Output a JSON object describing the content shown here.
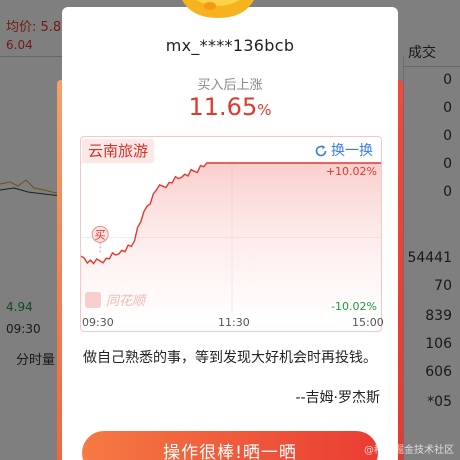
{
  "background_app": {
    "avg_price_label": "均价: 5.8",
    "price_top": "6.04",
    "price_bottom": "4.94",
    "time_start": "09:30",
    "tab_label": "分时量",
    "col_header": "成交",
    "right_column": [
      "0",
      "0",
      "0",
      "0",
      "0",
      "54441",
      "70",
      "839",
      "106",
      "606",
      "*05"
    ]
  },
  "modal": {
    "username": "mx_****136bcb",
    "result_label": "买入后上涨",
    "gain_value": "11.65",
    "gain_unit": "%",
    "stock_name": "云南旅游",
    "swap_label": "换一换",
    "buy_marker": "买",
    "brand": "同花顺",
    "axis_top": "+10.02%",
    "axis_bottom": "-10.02%",
    "time_labels": [
      "09:30",
      "11:30",
      "15:00"
    ],
    "quote": "做自己熟悉的事，等到发现大好机会时再投钱。",
    "author": "--吉姆·罗杰斯",
    "cta": "操作很棒!晒一晒"
  },
  "watermark": "@稀土掘金技术社区",
  "colors": {
    "up_red": "#e2382d",
    "down_green": "#1f9a3b",
    "link_blue": "#3a7ee3",
    "cta_start": "#f57a43",
    "cta_end": "#ea3c33"
  },
  "chart_data": {
    "type": "line",
    "x": [
      "09:30",
      "09:40",
      "09:50",
      "10:00",
      "10:10",
      "10:20",
      "10:30",
      "10:40",
      "10:50",
      "11:00",
      "11:10",
      "11:20",
      "11:30",
      "13:30",
      "14:00",
      "14:30",
      "15:00"
    ],
    "series": [
      {
        "values": [
          -2.5,
          -3.5,
          -2.8,
          -2.2,
          -1.2,
          3.5,
          6.4,
          7.4,
          8.1,
          8.9,
          10.02,
          10.02,
          10.02,
          10.02,
          10.02,
          10.02,
          10.02
        ]
      }
    ],
    "ylim": [
      -10.02,
      10.02
    ],
    "ylabel_top": "+10.02%",
    "ylabel_bottom": "-10.02%"
  }
}
